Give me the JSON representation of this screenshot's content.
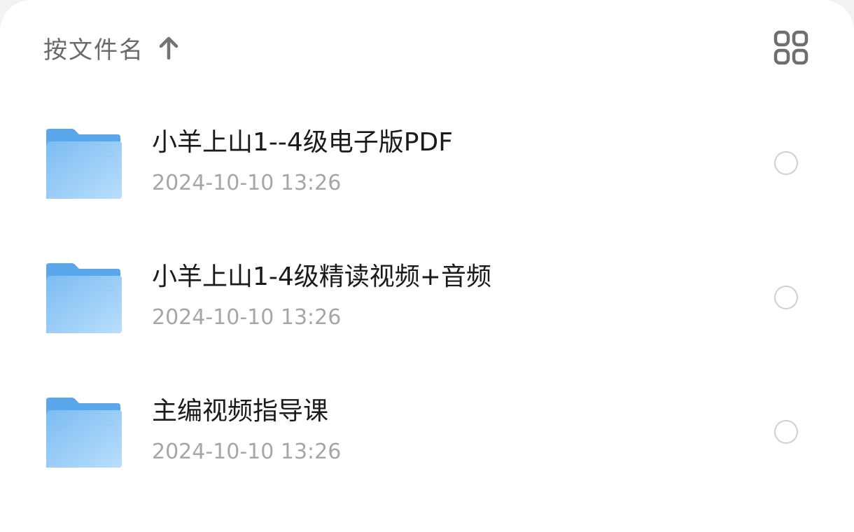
{
  "header": {
    "sort_label": "按文件名",
    "sort_icon": "arrow-up-icon",
    "view_icon": "grid-view-icon"
  },
  "colors": {
    "folder_light": "#b4dcfb",
    "folder_dark": "#6fb3ef",
    "folder_tab": "#5aa7ec",
    "text_primary": "#1a1a1a",
    "text_secondary": "#a6a6a6",
    "radio_border": "#cfcfcf"
  },
  "files": [
    {
      "name": "小羊上山1--4级电子版PDF",
      "date": "2024-10-10 13:26",
      "icon": "folder-icon",
      "selected": false
    },
    {
      "name": "小羊上山1-4级精读视频+音频",
      "date": "2024-10-10 13:26",
      "icon": "folder-icon",
      "selected": false
    },
    {
      "name": "主编视频指导课",
      "date": "2024-10-10 13:26",
      "icon": "folder-icon",
      "selected": false
    }
  ]
}
